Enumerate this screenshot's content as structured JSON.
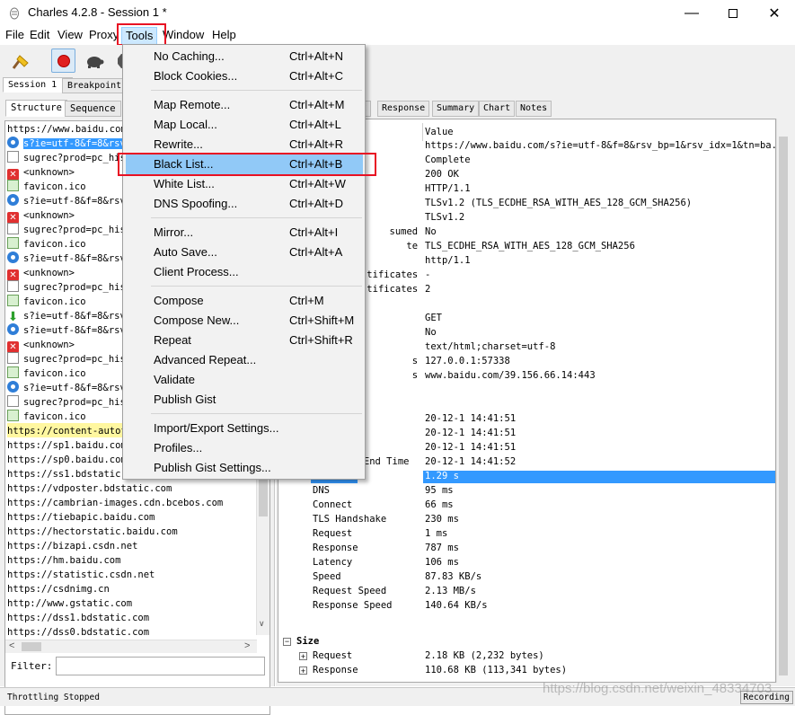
{
  "window": {
    "title": "Charles 4.2.8 - Session 1 *",
    "controls": [
      "minimize-icon",
      "maximize-icon",
      "close-icon"
    ]
  },
  "menubar": {
    "items": [
      "File",
      "Edit",
      "View",
      "Proxy",
      "Tools",
      "Window",
      "Help"
    ],
    "active": "Tools"
  },
  "session_tabs": [
    "Session 1 *",
    "Breakpoints"
  ],
  "left_tabs": [
    "Structure",
    "Sequence"
  ],
  "tree": [
    {
      "icon": "none",
      "text": "https://www.baidu.com"
    },
    {
      "icon": "info",
      "text": "s?ie=utf-8&f=8&rsv",
      "selected": true
    },
    {
      "icon": "doc",
      "text": "sugrec?prod=pc_his"
    },
    {
      "icon": "err",
      "text": "<unknown>"
    },
    {
      "icon": "img",
      "text": "favicon.ico"
    },
    {
      "icon": "info",
      "text": "s?ie=utf-8&f=8&rsv"
    },
    {
      "icon": "err",
      "text": "<unknown>"
    },
    {
      "icon": "doc",
      "text": "sugrec?prod=pc_his"
    },
    {
      "icon": "img",
      "text": "favicon.ico"
    },
    {
      "icon": "info",
      "text": "s?ie=utf-8&f=8&rsv"
    },
    {
      "icon": "err",
      "text": "<unknown>"
    },
    {
      "icon": "doc",
      "text": "sugrec?prod=pc_his"
    },
    {
      "icon": "img",
      "text": "favicon.ico"
    },
    {
      "icon": "down",
      "text": "s?ie=utf-8&f=8&rsv"
    },
    {
      "icon": "info",
      "text": "s?ie=utf-8&f=8&rsv"
    },
    {
      "icon": "err",
      "text": "<unknown>"
    },
    {
      "icon": "doc",
      "text": "sugrec?prod=pc_his"
    },
    {
      "icon": "img",
      "text": "favicon.ico"
    },
    {
      "icon": "info",
      "text": "s?ie=utf-8&f=8&rsv"
    },
    {
      "icon": "doc",
      "text": "sugrec?prod=pc_his"
    },
    {
      "icon": "img",
      "text": "favicon.ico"
    },
    {
      "icon": "none",
      "text": "https://content-autof",
      "highlight": true
    },
    {
      "icon": "none",
      "text": "https://sp1.baidu.com"
    },
    {
      "icon": "none",
      "text": "https://sp0.baidu.com"
    },
    {
      "icon": "none",
      "text": "https://ss1.bdstatic."
    },
    {
      "icon": "none",
      "text": "https://vdposter.bdstatic.com"
    },
    {
      "icon": "none",
      "text": "https://cambrian-images.cdn.bcebos.com"
    },
    {
      "icon": "none",
      "text": "https://tiebapic.baidu.com"
    },
    {
      "icon": "none",
      "text": "https://hectorstatic.baidu.com"
    },
    {
      "icon": "none",
      "text": "https://bizapi.csdn.net"
    },
    {
      "icon": "none",
      "text": "https://hm.baidu.com"
    },
    {
      "icon": "none",
      "text": "https://statistic.csdn.net"
    },
    {
      "icon": "none",
      "text": "https://csdnimg.cn"
    },
    {
      "icon": "none",
      "text": "http://www.gstatic.com"
    },
    {
      "icon": "none",
      "text": "https://dss1.bdstatic.com"
    },
    {
      "icon": "none",
      "text": "https://dss0.bdstatic.com"
    }
  ],
  "filter": {
    "label": "Filter:",
    "value": ""
  },
  "right_tabs": [
    "t",
    "Response",
    "Summary",
    "Chart",
    "Notes"
  ],
  "detail": {
    "value_header": "Value",
    "rows": [
      {
        "key": "",
        "value": "https://www.baidu.com/s?ie=utf-8&f=8&rsv_bp=1&rsv_idx=1&tn=ba..."
      },
      {
        "key": "",
        "value": "Complete"
      },
      {
        "key": "",
        "value": "200 OK"
      },
      {
        "key": "",
        "value": "HTTP/1.1"
      },
      {
        "key": "",
        "value": "TLSv1.2 (TLS_ECDHE_RSA_WITH_AES_128_GCM_SHA256)"
      },
      {
        "key": "",
        "value": "TLSv1.2"
      },
      {
        "key": "sumed",
        "value": "No"
      },
      {
        "key": "te",
        "value": "TLS_ECDHE_RSA_WITH_AES_128_GCM_SHA256"
      },
      {
        "key": "",
        "value": "http/1.1"
      },
      {
        "key": "tificates",
        "value": "-"
      },
      {
        "key": "tificates",
        "value": "2"
      },
      {
        "key": "",
        "value": ""
      },
      {
        "key": "",
        "value": "GET"
      },
      {
        "key": "",
        "value": "No"
      },
      {
        "key": "",
        "value": "text/html;charset=utf-8"
      },
      {
        "key": "s",
        "value": "127.0.0.1:57338"
      },
      {
        "key": "s",
        "value": "www.baidu.com/39.156.66.14:443"
      },
      {
        "key": "",
        "value": ""
      },
      {
        "key": "",
        "value": ""
      },
      {
        "key": "art Time",
        "value": "20-12-1 14:41:51"
      },
      {
        "key": "d Time",
        "value": "20-12-1 14:41:51"
      },
      {
        "key": "tart Time",
        "value": "20-12-1 14:41:51"
      },
      {
        "key": "Response End Time",
        "value": "20-12-1 14:41:52"
      },
      {
        "key": "Duration",
        "value": "1.29 s",
        "selected": true
      },
      {
        "key": "DNS",
        "value": "95 ms"
      },
      {
        "key": "Connect",
        "value": "66 ms"
      },
      {
        "key": "TLS Handshake",
        "value": "230 ms"
      },
      {
        "key": "Request",
        "value": "1 ms"
      },
      {
        "key": "Response",
        "value": "787 ms"
      },
      {
        "key": "Latency",
        "value": "106 ms"
      },
      {
        "key": "Speed",
        "value": "87.83 KB/s"
      },
      {
        "key": "Request Speed",
        "value": "2.13 MB/s"
      },
      {
        "key": "Response Speed",
        "value": "140.64 KB/s"
      }
    ],
    "size_group": {
      "label": "Size",
      "rows": [
        {
          "key": "Request",
          "value": "2.18 KB (2,232 bytes)"
        },
        {
          "key": "Response",
          "value": "110.68 KB (113,341 bytes)"
        }
      ]
    }
  },
  "tools_menu": {
    "groups": [
      [
        {
          "label": "No Caching...",
          "shortcut": "Ctrl+Alt+N"
        },
        {
          "label": "Block Cookies...",
          "shortcut": "Ctrl+Alt+C"
        }
      ],
      [
        {
          "label": "Map Remote...",
          "shortcut": "Ctrl+Alt+M"
        },
        {
          "label": "Map Local...",
          "shortcut": "Ctrl+Alt+L"
        },
        {
          "label": "Rewrite...",
          "shortcut": "Ctrl+Alt+R"
        },
        {
          "label": "Black List...",
          "shortcut": "Ctrl+Alt+B",
          "highlighted": true
        },
        {
          "label": "White List...",
          "shortcut": "Ctrl+Alt+W"
        },
        {
          "label": "DNS Spoofing...",
          "shortcut": "Ctrl+Alt+D"
        }
      ],
      [
        {
          "label": "Mirror...",
          "shortcut": "Ctrl+Alt+I"
        },
        {
          "label": "Auto Save...",
          "shortcut": "Ctrl+Alt+A"
        },
        {
          "label": "Client Process...",
          "shortcut": ""
        }
      ],
      [
        {
          "label": "Compose",
          "shortcut": "Ctrl+M"
        },
        {
          "label": "Compose New...",
          "shortcut": "Ctrl+Shift+M"
        },
        {
          "label": "Repeat",
          "shortcut": "Ctrl+Shift+R"
        },
        {
          "label": "Advanced Repeat...",
          "shortcut": ""
        },
        {
          "label": "Validate",
          "shortcut": ""
        },
        {
          "label": "Publish Gist",
          "shortcut": ""
        }
      ],
      [
        {
          "label": "Import/Export Settings...",
          "shortcut": ""
        },
        {
          "label": "Profiles...",
          "shortcut": ""
        },
        {
          "label": "Publish Gist Settings...",
          "shortcut": ""
        }
      ]
    ]
  },
  "status": {
    "text": "Throttling Stopped",
    "recording": "Recording"
  },
  "watermark": "https://blog.csdn.net/weixin_48334703",
  "colors": {
    "selection": "#3399ff",
    "menu_highlight": "#91c9f7",
    "annotation_red": "#e81123",
    "host_highlight": "#fff7a0"
  }
}
